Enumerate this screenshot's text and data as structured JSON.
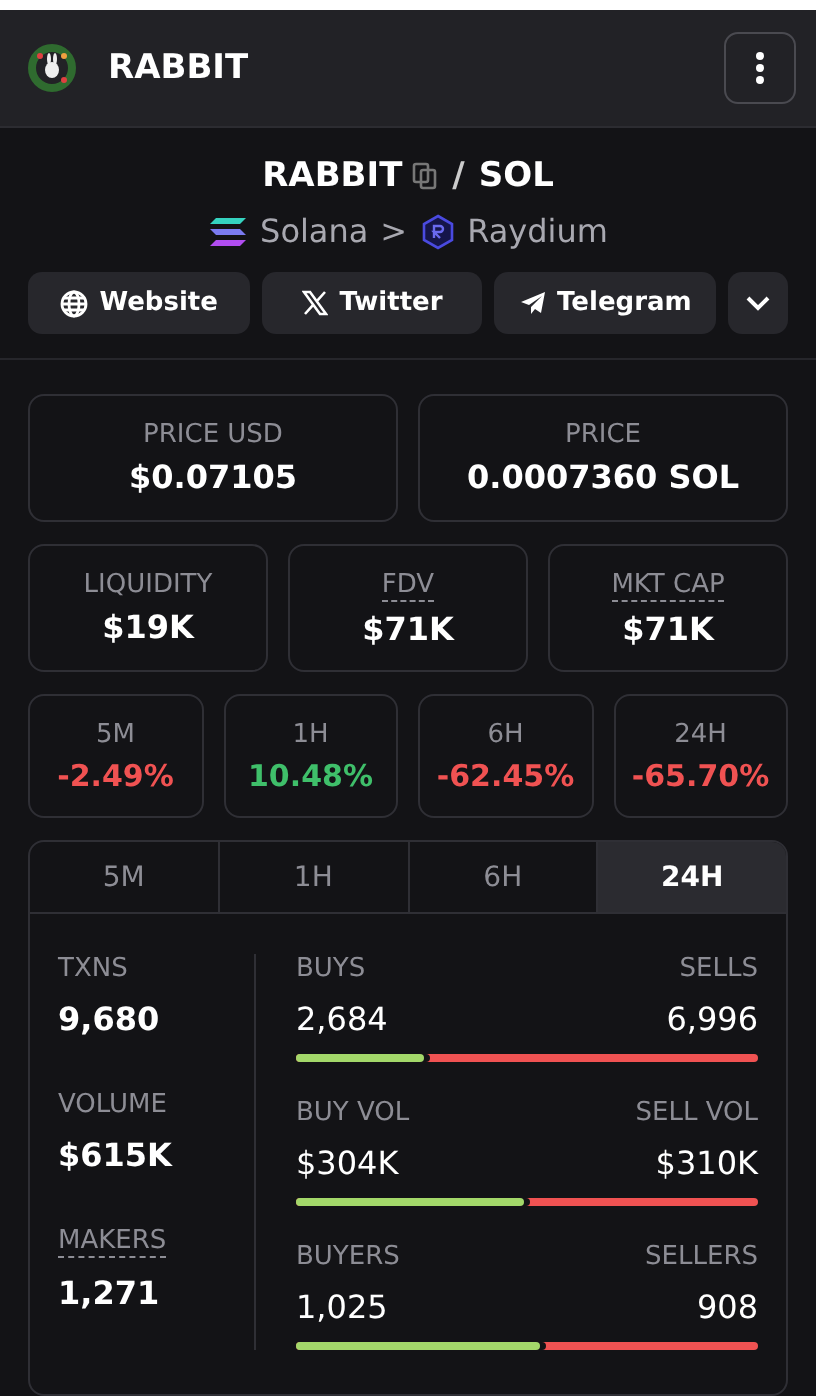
{
  "header": {
    "title": "RABBIT"
  },
  "pair": {
    "base": "RABBIT",
    "separator": "/",
    "quote": "SOL",
    "chain": "Solana",
    "chevron": ">",
    "dex": "Raydium"
  },
  "links": [
    {
      "kind": "globe",
      "label": "Website"
    },
    {
      "kind": "x",
      "label": "Twitter"
    },
    {
      "kind": "plane",
      "label": "Telegram"
    }
  ],
  "prices": [
    {
      "label": "PRICE USD",
      "value": "$0.07105"
    },
    {
      "label": "PRICE",
      "value": "0.0007360 SOL"
    }
  ],
  "metrics": [
    {
      "label": "LIQUIDITY",
      "value": "$19K",
      "dotted": false
    },
    {
      "label": "FDV",
      "value": "$71K",
      "dotted": true
    },
    {
      "label": "MKT CAP",
      "value": "$71K",
      "dotted": true
    }
  ],
  "changes": [
    {
      "label": "5M",
      "value": "-2.49%",
      "color": "#f05252"
    },
    {
      "label": "1H",
      "value": "10.48%",
      "color": "#3fbf6a"
    },
    {
      "label": "6H",
      "value": "-62.45%",
      "color": "#f05252"
    },
    {
      "label": "24H",
      "value": "-65.70%",
      "color": "#f05252"
    }
  ],
  "tabs": [
    {
      "label": "5M",
      "selected": false
    },
    {
      "label": "1H",
      "selected": false
    },
    {
      "label": "6H",
      "selected": false
    },
    {
      "label": "24H",
      "selected": true
    }
  ],
  "totals": [
    {
      "label": "TXNS",
      "value": "9,680",
      "dotted": false
    },
    {
      "label": "VOLUME",
      "value": "$615K",
      "dotted": false
    },
    {
      "label": "MAKERS",
      "value": "1,271",
      "dotted": true
    }
  ],
  "splits": [
    {
      "left_label": "BUYS",
      "right_label": "SELLS",
      "left_value": "2,684",
      "right_value": "6,996",
      "level": 0.277
    },
    {
      "left_label": "BUY VOL",
      "right_label": "SELL VOL",
      "left_value": "$304K",
      "right_value": "$310K",
      "level": 0.495
    },
    {
      "left_label": "BUYERS",
      "right_label": "SELLERS",
      "left_value": "1,025",
      "right_value": "908",
      "level": 0.53
    }
  ]
}
